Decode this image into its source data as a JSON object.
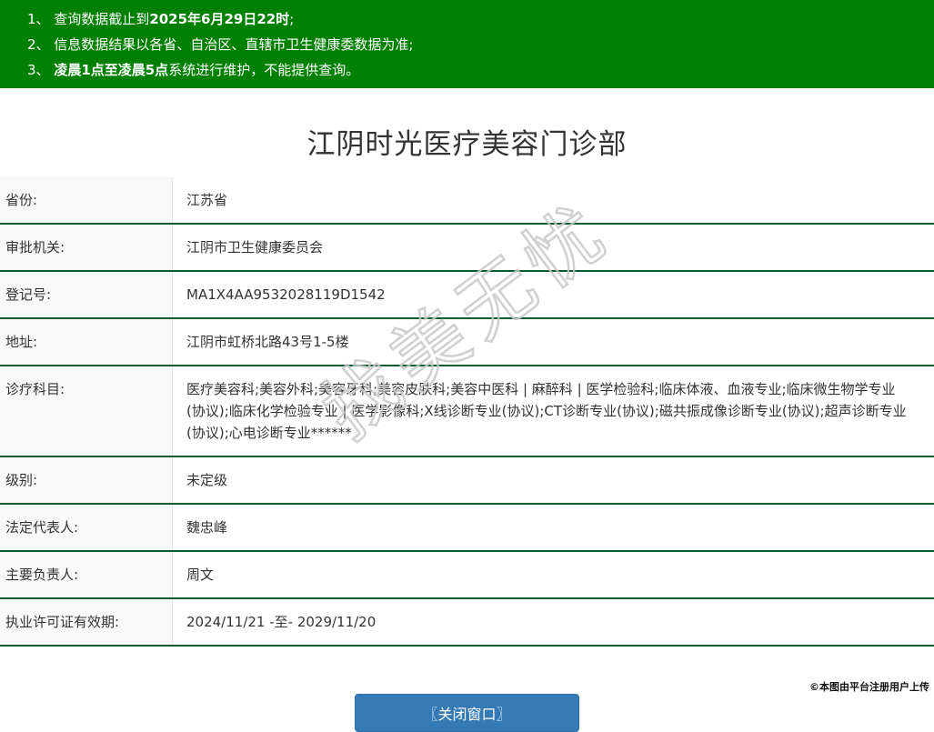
{
  "notice_bar": {
    "items": [
      {
        "segments": [
          {
            "text": "1、 查询数据截止到",
            "bold": false
          },
          {
            "text": "2025年6月29日22时",
            "bold": true
          },
          {
            "text": ";",
            "bold": false
          }
        ]
      },
      {
        "segments": [
          {
            "text": "2、 信息数据结果以各省、自治区、直辖市卫生健康委数据为准;",
            "bold": false
          }
        ]
      },
      {
        "segments": [
          {
            "text": "3、 ",
            "bold": false
          },
          {
            "text": "凌晨1点至凌晨5点",
            "bold": true
          },
          {
            "text": "系统进行维护，不能提供查询。",
            "bold": false
          }
        ]
      }
    ]
  },
  "page_title": "江阴时光医疗美容门诊部",
  "details": {
    "rows": [
      {
        "label": "省份:",
        "value": "江苏省"
      },
      {
        "label": "审批机关:",
        "value": "江阴市卫生健康委员会"
      },
      {
        "label": "登记号:",
        "value": "MA1X4AA9532028119D1542"
      },
      {
        "label": "地址:",
        "value": "江阴市虹桥北路43号1-5楼"
      },
      {
        "label": "诊疗科目:",
        "value": "医疗美容科;美容外科;美容牙科;美容皮肤科;美容中医科 | 麻醉科 | 医学检验科;临床体液、血液专业;临床微生物学专业(协议);临床化学检验专业 | 医学影像科;X线诊断专业(协议);CT诊断专业(协议);磁共振成像诊断专业(协议);超声诊断专业(协议);心电诊断专业******"
      },
      {
        "label": "级别:",
        "value": "未定级"
      },
      {
        "label": "法定代表人:",
        "value": "魏忠峰"
      },
      {
        "label": "主要负责人:",
        "value": "周文"
      },
      {
        "label": "执业许可证有效期:",
        "value": "2024/11/21 -至- 2029/11/20"
      }
    ]
  },
  "close_button_label": "〖关闭窗口〗",
  "watermark_text": "找美无忧",
  "footer_note": "©本图由平台注册用户上传",
  "colors": {
    "notice_bg": "#008000",
    "table_line": "#04582e",
    "label_bg": "#f8f8f8",
    "button_bg": "#337ab7",
    "watermark_stroke": "#c8c8c8"
  }
}
